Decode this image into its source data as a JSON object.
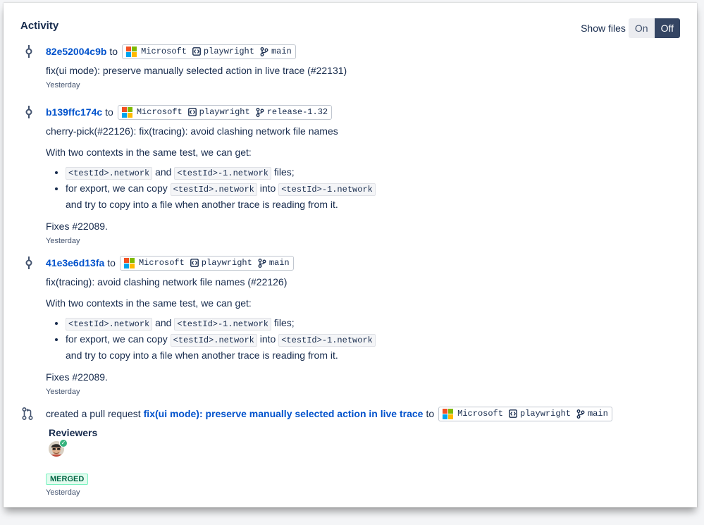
{
  "activity": {
    "title": "Activity"
  },
  "show_files": {
    "label": "Show files",
    "on": "On",
    "off": "Off",
    "selected": "Off"
  },
  "colors": {
    "accent": "#0052cc",
    "toggle_active": "#344563",
    "merged_bg": "#e3fcef",
    "merged_text": "#006644"
  },
  "entries": [
    {
      "sha": "82e52004c9b",
      "to": "to",
      "repo_owner": "Microsoft",
      "repo": "playwright",
      "branch": "main",
      "message": "fix(ui mode): preserve manually selected action in live trace (#22131)",
      "time": "Yesterday"
    },
    {
      "sha": "b139ffc174c",
      "to": "to",
      "repo_owner": "Microsoft",
      "repo": "playwright",
      "branch": "release-1.32",
      "message": "cherry-pick(#22126): fix(tracing): avoid clashing network file names",
      "para": "With two contexts in the same test, we can get:",
      "b1_c1": "<testId>.network",
      "b1_and": "and",
      "b1_c2": "<testId>-1.network",
      "b1_end": "files;",
      "b2_pre": "for export, we can copy",
      "b2_c1": "<testId>.network",
      "b2_into": "into",
      "b2_c2": "<testId>-1.network",
      "b2_cont": "and try to copy into a file when another trace is reading from it.",
      "fixes": "Fixes #22089.",
      "time": "Yesterday"
    },
    {
      "sha": "41e3e6d13fa",
      "to": "to",
      "repo_owner": "Microsoft",
      "repo": "playwright",
      "branch": "main",
      "message": "fix(tracing): avoid clashing network file names (#22126)",
      "para": "With two contexts in the same test, we can get:",
      "b1_c1": "<testId>.network",
      "b1_and": "and",
      "b1_c2": "<testId>-1.network",
      "b1_end": "files;",
      "b2_pre": "for export, we can copy",
      "b2_c1": "<testId>.network",
      "b2_into": "into",
      "b2_c2": "<testId>-1.network",
      "b2_cont": "and try to copy into a file when another trace is reading from it.",
      "fixes": "Fixes #22089.",
      "time": "Yesterday"
    }
  ],
  "pull_request": {
    "action": "created a pull request",
    "title": "fix(ui mode): preserve manually selected action in live trace",
    "to": "to",
    "repo_owner": "Microsoft",
    "repo": "playwright",
    "branch": "main",
    "reviewers_label": "Reviewers",
    "status": "MERGED",
    "time": "Yesterday"
  }
}
